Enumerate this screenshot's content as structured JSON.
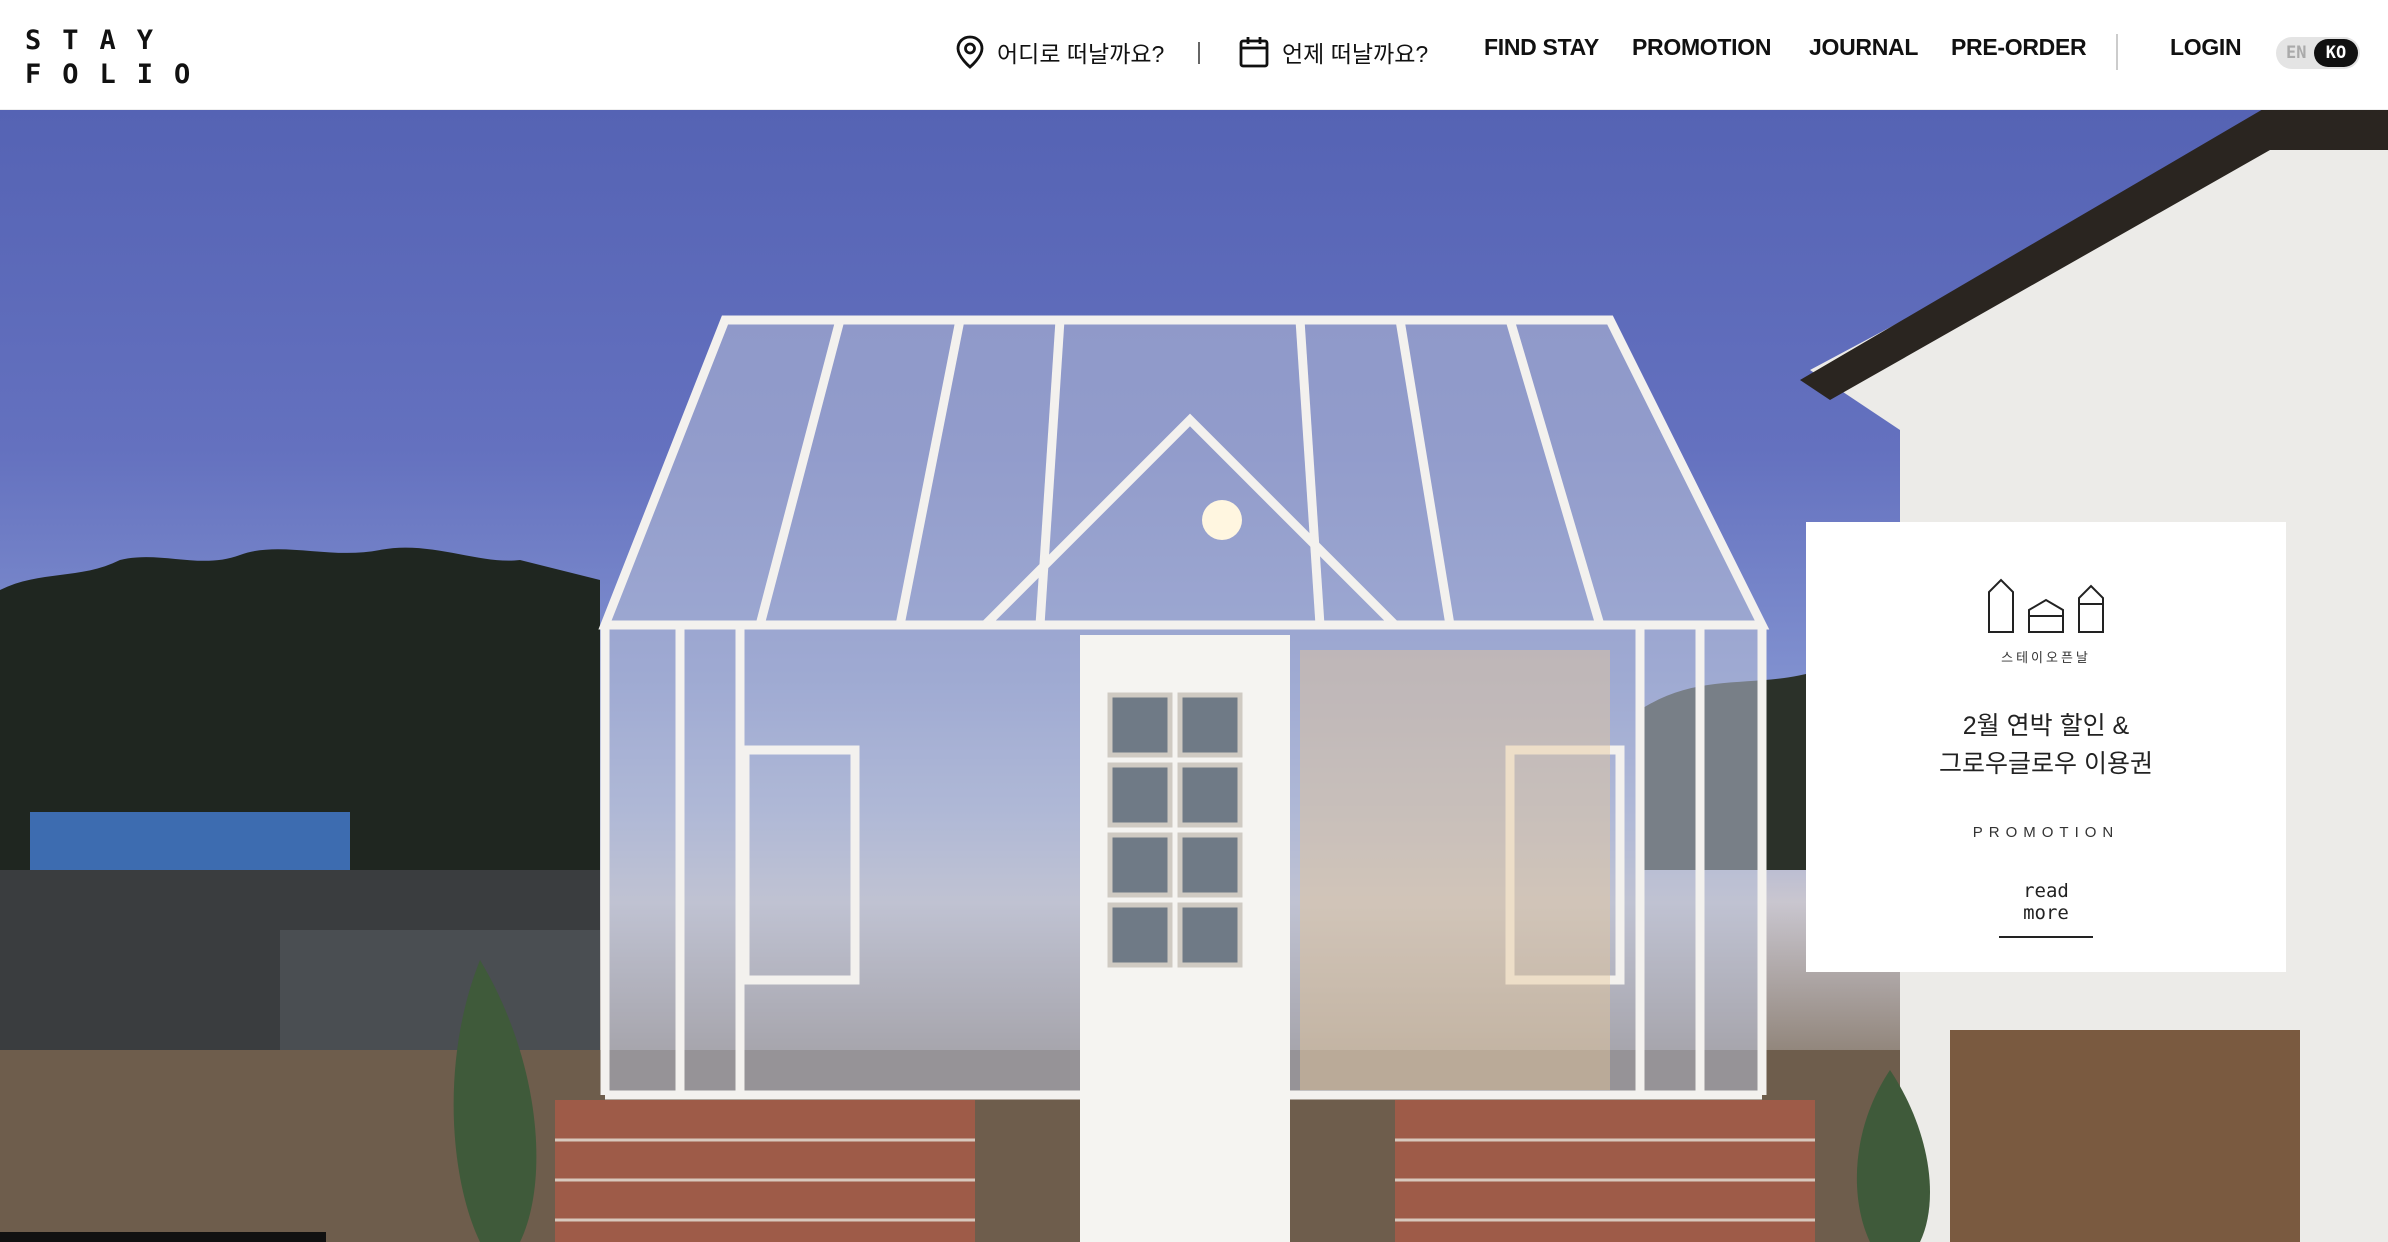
{
  "header": {
    "logo": {
      "line1": "STAY",
      "line2": "FOLIO"
    },
    "search": {
      "where_label": "어디로 떠날까요?",
      "where_icon": "location-pin-icon",
      "divider": "|",
      "when_label": "언제 떠날까요?",
      "when_icon": "calendar-icon"
    },
    "nav": [
      {
        "label": "FIND STAY"
      },
      {
        "label": "PROMOTION"
      },
      {
        "label": "JOURNAL"
      },
      {
        "label": "PRE-ORDER"
      }
    ],
    "login_label": "LOGIN",
    "language": {
      "en": "EN",
      "ko": "KO",
      "selected": "KO"
    }
  },
  "hero": {
    "description_icon": "greenhouse-photo",
    "promo_card": {
      "brand": "스테이오픈날",
      "title_line1": "2월 연박 할인 &",
      "title_line2": "그로우글로우 이용권",
      "category": "PROMOTION",
      "link": "read more",
      "icon": "houses-icon"
    }
  },
  "colors": {
    "sky": "#5563b4",
    "text": "#111111",
    "card_bg": "#ffffff",
    "toggle_active": "#111111"
  }
}
